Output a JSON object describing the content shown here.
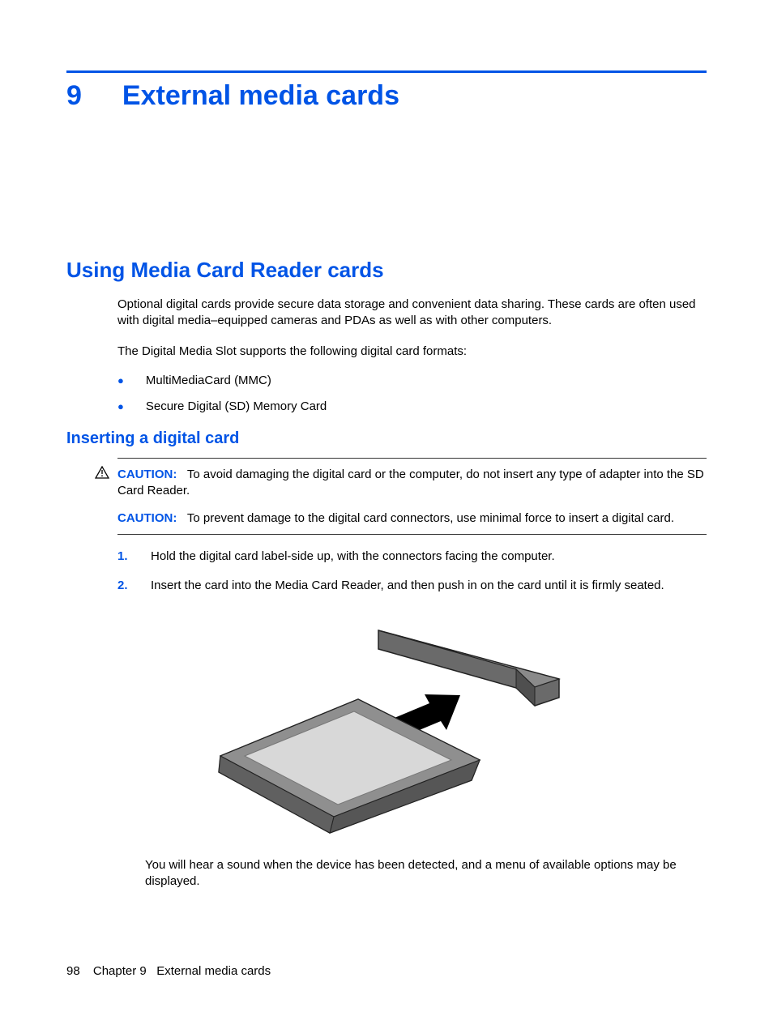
{
  "chapter": {
    "number": "9",
    "title": "External media cards"
  },
  "section": {
    "title": "Using Media Card Reader cards",
    "para1": "Optional digital cards provide secure data storage and convenient data sharing. These cards are often used with digital media–equipped cameras and PDAs as well as with other computers.",
    "para2": "The Digital Media Slot supports the following digital card formats:",
    "bullets": [
      "MultiMediaCard (MMC)",
      "Secure Digital (SD) Memory Card"
    ]
  },
  "subsection": {
    "title": "Inserting a digital card",
    "caution1_label": "CAUTION:",
    "caution1_text": "To avoid damaging the digital card or the computer, do not insert any type of adapter into the SD Card Reader.",
    "caution2_label": "CAUTION:",
    "caution2_text": "To prevent damage to the digital card connectors, use minimal force to insert a digital card.",
    "steps": [
      {
        "num": "1.",
        "text": "Hold the digital card label-side up, with the connectors facing the computer."
      },
      {
        "num": "2.",
        "text": "Insert the card into the Media Card Reader, and then push in on the card until it is firmly seated."
      }
    ],
    "after_illustration": "You will hear a sound when the device has been detected, and a menu of available options may be displayed."
  },
  "footer": {
    "page": "98",
    "chapter_label": "Chapter 9",
    "chapter_title": "External media cards"
  }
}
